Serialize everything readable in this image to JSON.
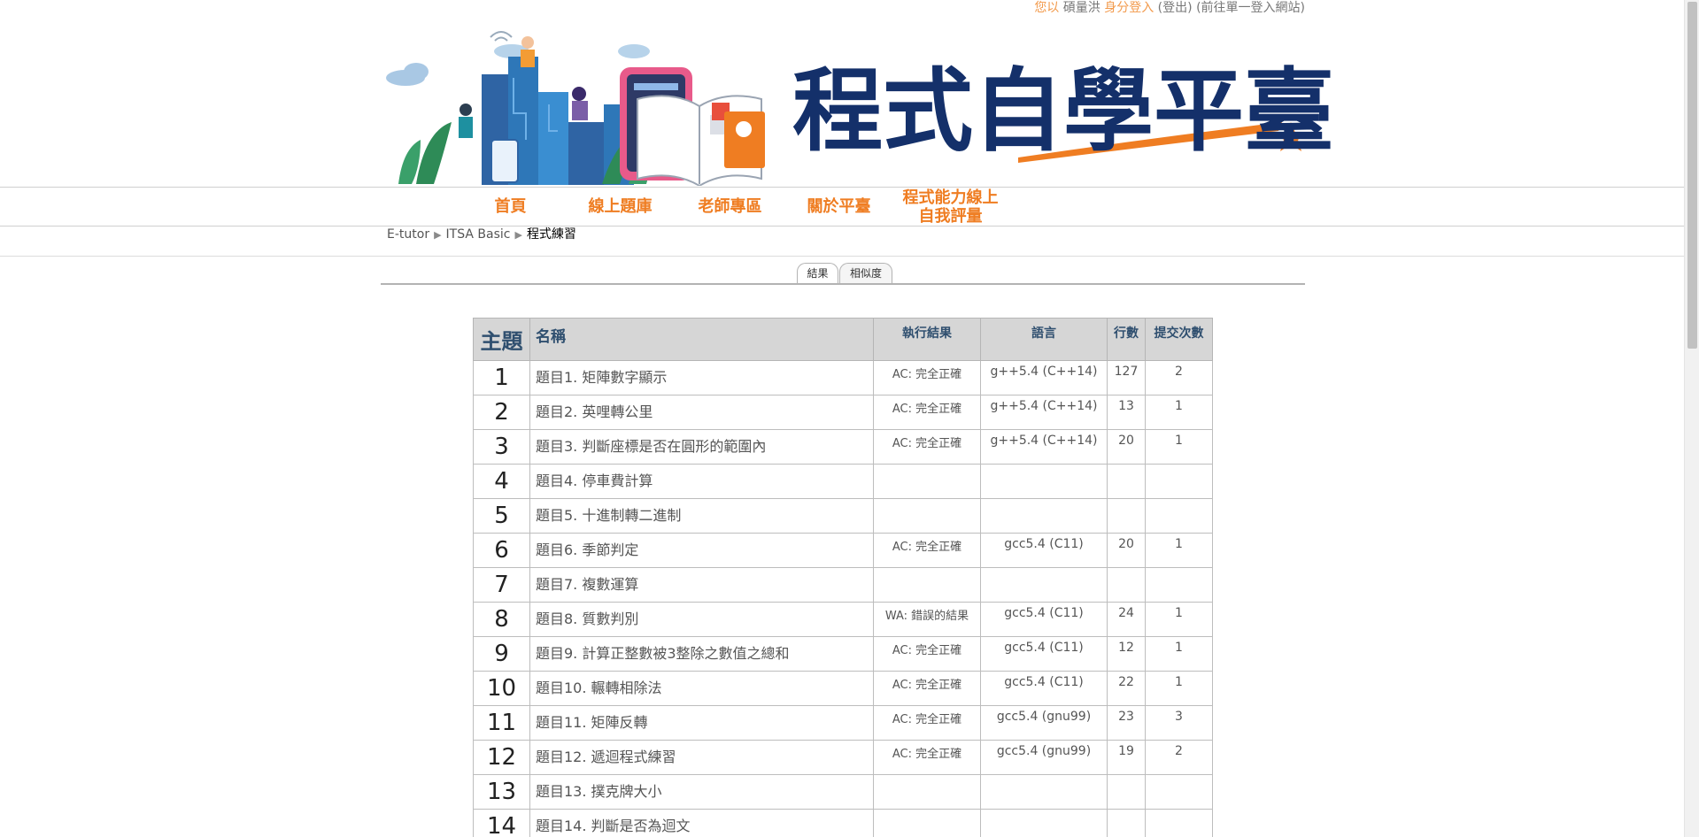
{
  "login": {
    "prefix": "您以",
    "user": "碩量洪",
    "suffix": "身分登入",
    "logout": "(登出)",
    "sso": "(前往單一登入網站)"
  },
  "banner": {
    "title": "程式自學平臺"
  },
  "nav": [
    {
      "label": "首頁"
    },
    {
      "label": "線上題庫"
    },
    {
      "label": "老師專區"
    },
    {
      "label": "關於平臺"
    },
    {
      "label": "程式能力線上\n自我評量"
    }
  ],
  "breadcrumb": [
    "E-tutor",
    "ITSA Basic",
    "程式練習"
  ],
  "tabs": [
    "結果",
    "相似度"
  ],
  "table": {
    "headers": {
      "topic": "主題",
      "name": "名稱",
      "result": "執行結果",
      "lang": "語言",
      "lines": "行數",
      "subs": "提交次數"
    },
    "rows": [
      {
        "n": "1",
        "name": "題目1. 矩陣數字顯示",
        "result": "AC: 完全正確",
        "lang": "g++5.4 (C++14)",
        "lines": "127",
        "subs": "2"
      },
      {
        "n": "2",
        "name": "題目2. 英哩轉公里",
        "result": "AC: 完全正確",
        "lang": "g++5.4 (C++14)",
        "lines": "13",
        "subs": "1"
      },
      {
        "n": "3",
        "name": "題目3. 判斷座標是否在圓形的範圍內",
        "result": "AC: 完全正確",
        "lang": "g++5.4 (C++14)",
        "lines": "20",
        "subs": "1"
      },
      {
        "n": "4",
        "name": "題目4. 停車費計算",
        "result": "",
        "lang": "",
        "lines": "",
        "subs": ""
      },
      {
        "n": "5",
        "name": "題目5. 十進制轉二進制",
        "result": "",
        "lang": "",
        "lines": "",
        "subs": ""
      },
      {
        "n": "6",
        "name": "題目6. 季節判定",
        "result": "AC: 完全正確",
        "lang": "gcc5.4 (C11)",
        "lines": "20",
        "subs": "1"
      },
      {
        "n": "7",
        "name": "題目7. 複數運算",
        "result": "",
        "lang": "",
        "lines": "",
        "subs": ""
      },
      {
        "n": "8",
        "name": "題目8. 質數判別",
        "result": "WA: 錯誤的結果",
        "lang": "gcc5.4 (C11)",
        "lines": "24",
        "subs": "1"
      },
      {
        "n": "9",
        "name": "題目9. 計算正整數被3整除之數值之總和",
        "result": "AC: 完全正確",
        "lang": "gcc5.4 (C11)",
        "lines": "12",
        "subs": "1"
      },
      {
        "n": "10",
        "name": "題目10. 輾轉相除法",
        "result": "AC: 完全正確",
        "lang": "gcc5.4 (C11)",
        "lines": "22",
        "subs": "1"
      },
      {
        "n": "11",
        "name": "題目11. 矩陣反轉",
        "result": "AC: 完全正確",
        "lang": "gcc5.4 (gnu99)",
        "lines": "23",
        "subs": "3"
      },
      {
        "n": "12",
        "name": "題目12. 遞迴程式練習",
        "result": "AC: 完全正確",
        "lang": "gcc5.4 (gnu99)",
        "lines": "19",
        "subs": "2"
      },
      {
        "n": "13",
        "name": "題目13. 撲克牌大小",
        "result": "",
        "lang": "",
        "lines": "",
        "subs": ""
      },
      {
        "n": "14",
        "name": "題目14. 判斷是否為迴文",
        "result": "",
        "lang": "",
        "lines": "",
        "subs": ""
      }
    ]
  }
}
